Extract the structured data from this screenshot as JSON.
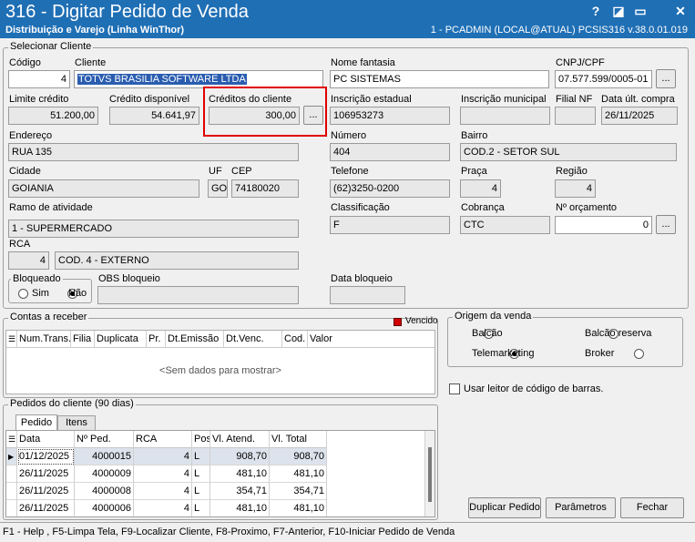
{
  "window": {
    "title": "316 - Digitar Pedido de Venda",
    "subtitle": "Distribuição e Varejo (Linha WinThor)",
    "info": "1 - PCADMIN (LOCAL@ATUAL)   PCSIS316  v.38.0.01.019",
    "help": "?",
    "restore": "◪",
    "minimize": "▭",
    "close": "✕"
  },
  "cliente": {
    "group_label": "Selecionar Cliente",
    "codigo_label": "Código",
    "codigo": "4",
    "cliente_label": "Cliente",
    "cliente": "TOTVS BRASILIA SOFTWARE LTDA",
    "fantasia_label": "Nome fantasia",
    "fantasia": "PC SISTEMAS",
    "cnpj_label": "CNPJ/CPF",
    "cnpj": "07.577.599/0005-01",
    "limite_label": "Limite crédito",
    "limite": "51.200,00",
    "disp_label": "Crédito disponível",
    "disp": "54.641,97",
    "creditos_label": "Créditos do cliente",
    "creditos": "300,00",
    "ie_label": "Inscrição estadual",
    "ie": "106953273",
    "im_label": "Inscrição municipal",
    "im": "",
    "filial_label": "Filial NF",
    "filial": "",
    "data_ult_label": "Data últ. compra",
    "data_ult": "26/11/2025",
    "endereco_label": "Endereço",
    "endereco": "RUA 135",
    "numero_label": "Número",
    "numero": "404",
    "bairro_label": "Bairro",
    "bairro": "COD.2 - SETOR SUL",
    "cidade_label": "Cidade",
    "cidade": "GOIANIA",
    "uf_label": "UF",
    "uf": "GO",
    "cep_label": "CEP",
    "cep": "74180020",
    "telefone_label": "Telefone",
    "telefone": "(62)3250-0200",
    "praca_label": "Praça",
    "praca": "4",
    "regiao_label": "Região",
    "regiao": "4",
    "ramo_label": "Ramo de atividade",
    "ramo": "1 - SUPERMERCADO",
    "classif_label": "Classificação",
    "classif": "F",
    "cobranca_label": "Cobrança",
    "cobranca": "CTC",
    "orcamento_label": "Nº orçamento",
    "orcamento": "0",
    "rca_label": "RCA",
    "rca_cod": "4",
    "rca_nome": "COD. 4 - EXTERNO",
    "bloqueado_label": "Bloqueado",
    "sim_label": "Sim",
    "nao_label": "Não",
    "obs_label": "OBS bloqueio",
    "obs": "",
    "data_bloq_label": "Data bloqueio",
    "data_bloq": "",
    "ellipsis": "..."
  },
  "contas": {
    "label": "Contas a receber",
    "vencido_label": "Vencido",
    "vencido_color": "#d00000",
    "columns": [
      "Num.Trans.V",
      "Filia",
      "Duplicata",
      "Pr.",
      "Dt.Emissão",
      "Dt.Venc.",
      "Cod.",
      "Valor"
    ],
    "empty": "<Sem dados para mostrar>"
  },
  "origem": {
    "label": "Origem da venda",
    "balcao": "Balcão",
    "balcao_reserva": "Balcão reserva",
    "telemarketing": "Telemarketing",
    "broker": "Broker"
  },
  "leitor_label": "Usar leitor de código de barras.",
  "pedidos": {
    "label": "Pedidos do cliente (90 dias)",
    "tab_pedido": "Pedido",
    "tab_itens": "Itens",
    "columns": [
      "Data",
      "Nº Ped.",
      "RCA",
      "Pos",
      "Vl. Atend.",
      "Vl. Total"
    ],
    "rows": [
      [
        "01/12/2025",
        "4000015",
        "4",
        "L",
        "908,70",
        "908,70"
      ],
      [
        "26/11/2025",
        "4000009",
        "4",
        "L",
        "481,10",
        "481,10"
      ],
      [
        "26/11/2025",
        "4000008",
        "4",
        "L",
        "354,71",
        "354,71"
      ],
      [
        "26/11/2025",
        "4000006",
        "4",
        "L",
        "481,10",
        "481,10"
      ]
    ]
  },
  "buttons": {
    "duplicar": "Duplicar Pedido",
    "parametros": "Parâmetros",
    "fechar": "Fechar"
  },
  "status": "F1 - Help , F5-Limpa Tela, F9-Localizar Cliente, F8-Proximo, F7-Anterior, F10-Iniciar Pedido de Venda"
}
